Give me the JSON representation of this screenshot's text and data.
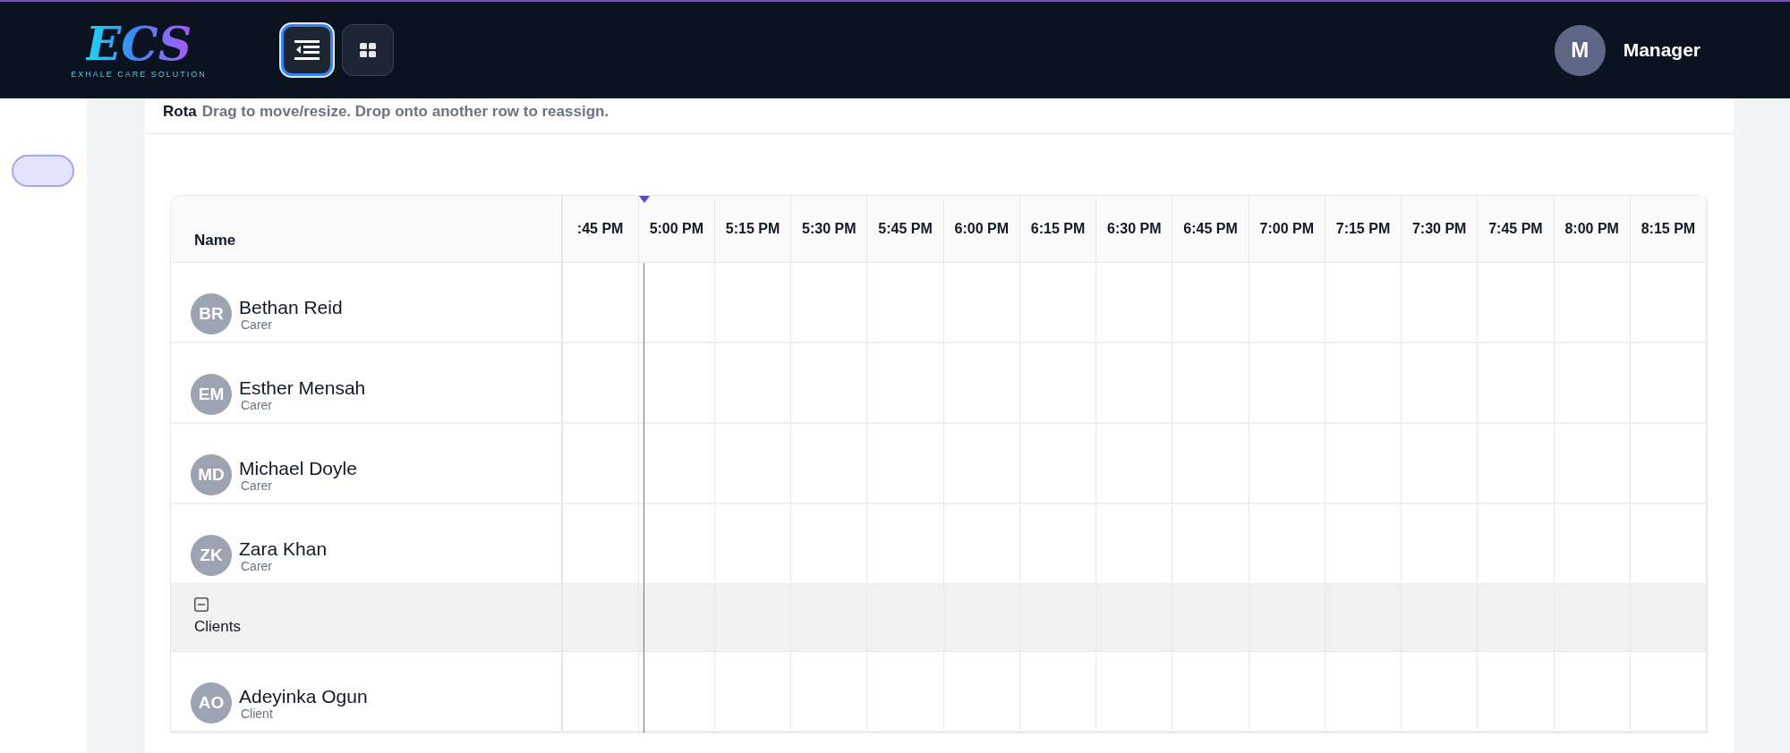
{
  "header": {
    "logo": {
      "title": "ECS",
      "subtitle": "EXHALE CARE SOLUTION"
    },
    "view_buttons": [
      {
        "kind": "list",
        "selected": true
      },
      {
        "kind": "grid",
        "selected": false
      }
    ],
    "user": {
      "initial": "M",
      "name": "Manager"
    }
  },
  "rota": {
    "title": "Rota",
    "hint": "Drag to move/resize. Drop onto another row to reassign."
  },
  "table": {
    "name_header": "Name",
    "time_columns": [
      {
        "label": ":45 PM",
        "current": false
      },
      {
        "label": "5:00 PM",
        "current": true
      },
      {
        "label": "5:15 PM",
        "current": false
      },
      {
        "label": "5:30 PM",
        "current": false
      },
      {
        "label": "5:45 PM",
        "current": false
      },
      {
        "label": "6:00 PM",
        "current": false
      },
      {
        "label": "6:15 PM",
        "current": false
      },
      {
        "label": "6:30 PM",
        "current": false
      },
      {
        "label": "6:45 PM",
        "current": false
      },
      {
        "label": "7:00 PM",
        "current": false
      },
      {
        "label": "7:15 PM",
        "current": false
      },
      {
        "label": "7:30 PM",
        "current": false
      },
      {
        "label": "7:45 PM",
        "current": false
      },
      {
        "label": "8:00 PM",
        "current": false
      },
      {
        "label": "8:15 PM",
        "current": false
      }
    ],
    "rows": [
      {
        "kind": "person",
        "initials": "BR",
        "name": "Bethan Reid",
        "role": "Carer"
      },
      {
        "kind": "person",
        "initials": "EM",
        "name": "Esther Mensah",
        "role": "Carer"
      },
      {
        "kind": "person",
        "initials": "MD",
        "name": "Michael Doyle",
        "role": "Carer"
      },
      {
        "kind": "person",
        "initials": "ZK",
        "name": "Zara Khan",
        "role": "Carer"
      },
      {
        "kind": "group",
        "label": "Clients",
        "expanded": true
      },
      {
        "kind": "person",
        "initials": "AO",
        "name": "Adeyinka Ogun",
        "role": "Client"
      }
    ]
  }
}
